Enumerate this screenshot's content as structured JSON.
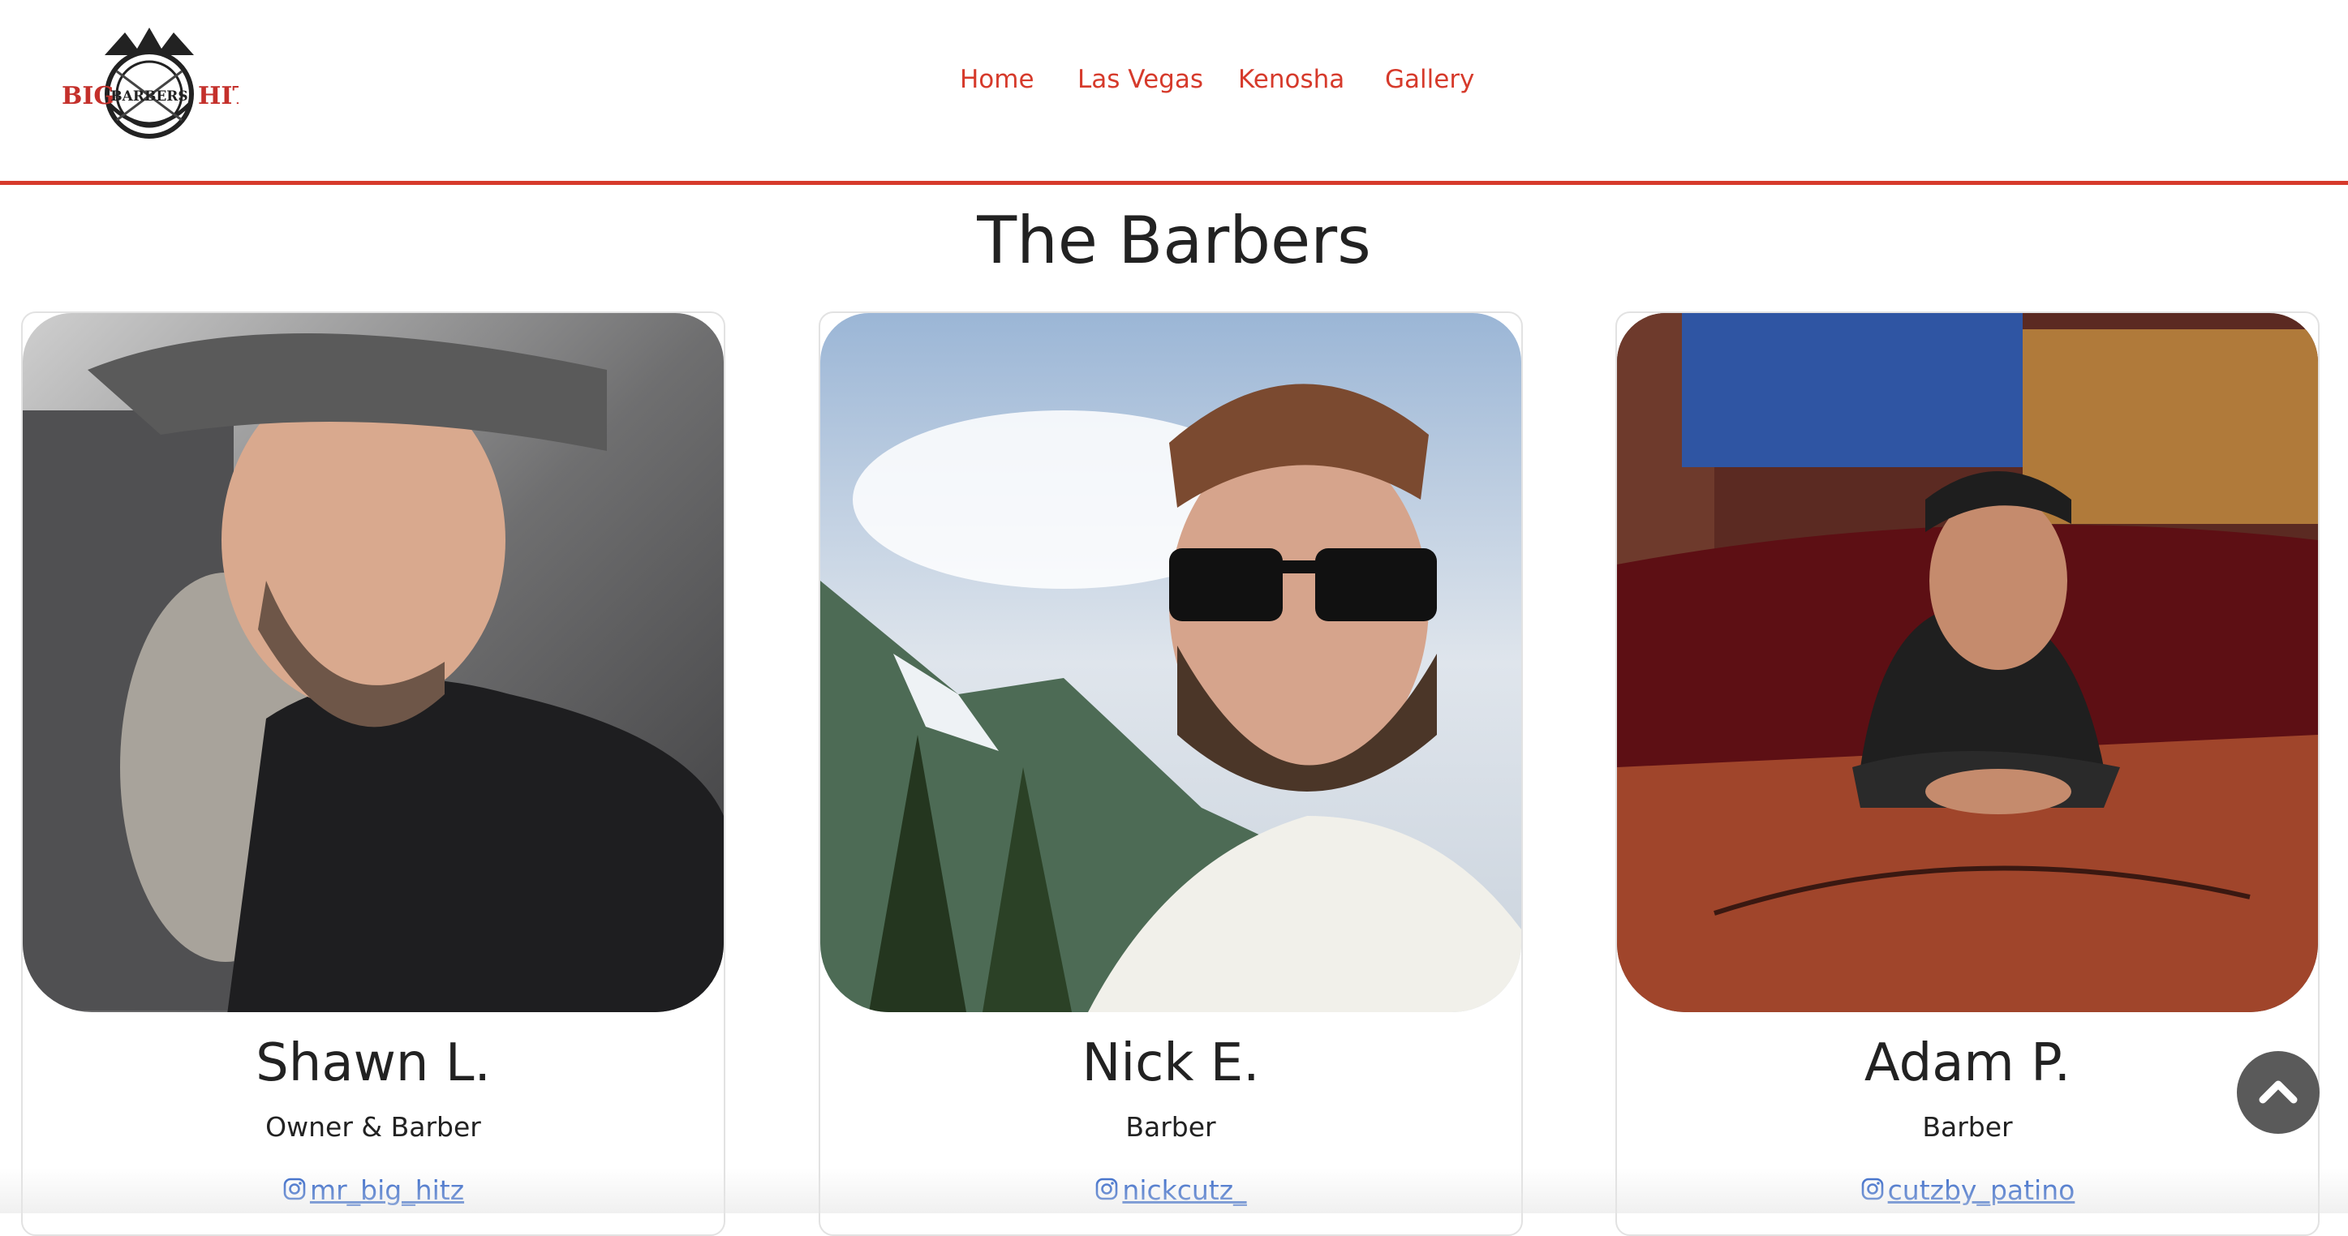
{
  "brand": {
    "logo_text_left": "BIG",
    "logo_text_center": "BARBERS",
    "logo_text_right": "HIT",
    "accent": "#d63a2b"
  },
  "nav": {
    "items": [
      {
        "label": "Home"
      },
      {
        "label": "Las Vegas"
      },
      {
        "label": "Kenosha"
      },
      {
        "label": "Gallery"
      }
    ]
  },
  "page": {
    "title": "The Barbers"
  },
  "barbers": [
    {
      "name": "Shawn L.",
      "role": "Owner & Barber",
      "instagram": "mr_big_hitz",
      "icon": "instagram-icon"
    },
    {
      "name": "Nick E.",
      "role": "Barber",
      "instagram": "nickcutz_",
      "icon": "instagram-icon"
    },
    {
      "name": "Adam P.",
      "role": "Barber",
      "instagram": "cutzby_patino",
      "icon": "instagram-icon"
    }
  ],
  "scroll_top": {
    "icon": "chevron-up-icon"
  }
}
